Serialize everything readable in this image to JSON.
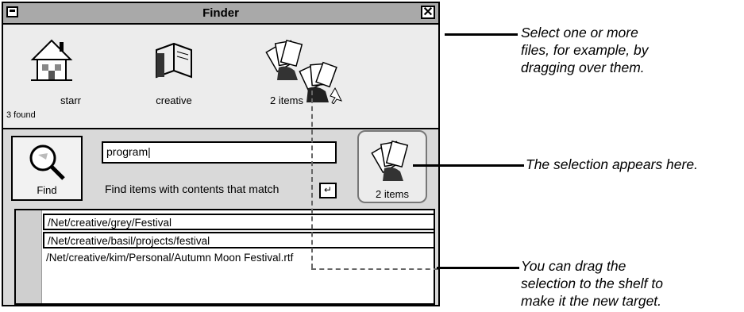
{
  "window": {
    "title": "Finder"
  },
  "shelf": {
    "items": [
      {
        "label": "starr"
      },
      {
        "label": "creative"
      },
      {
        "label": "2 items"
      }
    ],
    "found_count": "3 found"
  },
  "find": {
    "button_label": "Find",
    "search_value": "program",
    "match_mode": "Find items with contents that match",
    "enter_glyph": "↵"
  },
  "target": {
    "label": "2 items"
  },
  "results": [
    "/Net/creative/grey/Festival",
    "/Net/creative/basil/projects/festival",
    "/Net/creative/kim/Personal/Autumn Moon Festival.rtf"
  ],
  "annotations": {
    "select_lines": [
      "Select one or more",
      "files, for example, by",
      "dragging over them."
    ],
    "selection_appears": "The selection appears here.",
    "drag_lines": [
      "You can drag the",
      "selection to the shelf to",
      "make it the new target."
    ]
  }
}
